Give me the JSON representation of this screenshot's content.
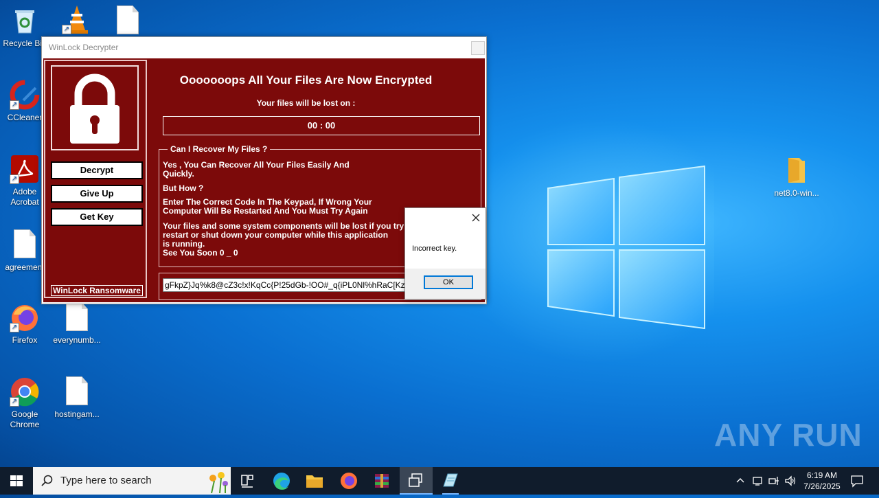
{
  "desktop": {
    "icons": [
      {
        "label": "Recycle Bin",
        "icon": "recycle-bin-icon"
      },
      {
        "label": "",
        "icon": "vlc-icon"
      },
      {
        "label": "",
        "icon": "document-icon"
      },
      {
        "label": "CCleaner",
        "icon": "ccleaner-icon"
      },
      {
        "label": "Adobe Acrobat",
        "icon": "adobe-acrobat-icon"
      },
      {
        "label": "agreement",
        "icon": "document-icon"
      },
      {
        "label": "Firefox",
        "icon": "firefox-icon"
      },
      {
        "label": "everynumb...",
        "icon": "document-icon"
      },
      {
        "label": "Google Chrome",
        "icon": "chrome-icon"
      },
      {
        "label": "hostingam...",
        "icon": "document-icon"
      },
      {
        "label": "net8.0-win...",
        "icon": "folder-icon"
      }
    ]
  },
  "ransom_window": {
    "title": "WinLock Decrypter",
    "headline": "Ooooooops All Your Files Are Now Encrypted",
    "subheadline": "Your files will be lost on :",
    "timer": "00 : 00",
    "buttons": {
      "decrypt": "Decrypt",
      "give_up": "Give Up",
      "get_key": "Get Key"
    },
    "brand": "WinLock Ransomware",
    "group_title": "Can I Recover My Files ?",
    "text": {
      "p1": "Yes , You Can Recover All Your Files Easily And\nQuickly.",
      "p2": "But How ?",
      "p3": "Enter The Correct Code In The Keypad, If Wrong Your\nComputer Will Be Restarted And You Must Try Again",
      "p4": "Your files and some system components will be lost if you try to\nrestart or shut down your computer while this application\n is running.\nSee You Soon 0 _ 0"
    },
    "key_input_value": "gFkpZ}Jq%k8@cZ3c!x!KqCc{P!25dGb-!OO#_q{iPL0Nl%hRaC[Kz",
    "accent_color": "#7c0a0a"
  },
  "message_box": {
    "text": "Incorrect key.",
    "ok_label": "OK"
  },
  "watermark": "ANY RUN",
  "taskbar": {
    "search_placeholder": "Type here to search",
    "apps": [
      "task-view",
      "edge",
      "file-explorer",
      "firefox",
      "winrar",
      "winlock-window",
      "notepad"
    ],
    "time": "6:19 AM",
    "date": "7/26/2025"
  }
}
